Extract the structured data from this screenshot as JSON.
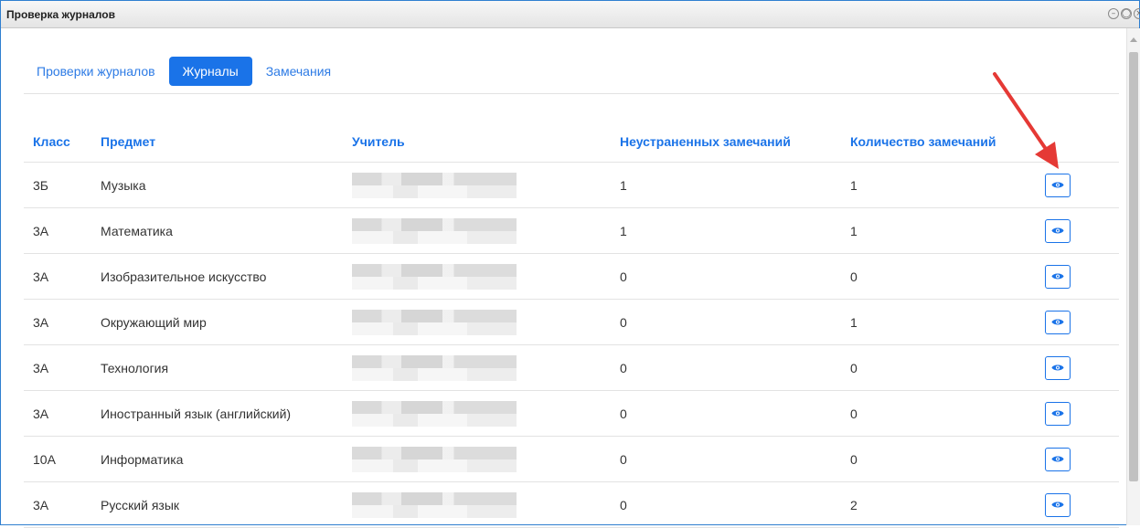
{
  "window": {
    "title": "Проверка журналов",
    "controls": [
      "–",
      "◯",
      "×"
    ]
  },
  "tabs": [
    {
      "label": "Проверки журналов",
      "active": false
    },
    {
      "label": "Журналы",
      "active": true
    },
    {
      "label": "Замечания",
      "active": false
    }
  ],
  "table": {
    "headers": {
      "class": "Класс",
      "subject": "Предмет",
      "teacher": "Учитель",
      "open_remarks": "Неустраненных замечаний",
      "total_remarks": "Количество замечаний"
    },
    "rows": [
      {
        "class": "3Б",
        "subject": "Музыка",
        "open": "1",
        "total": "1"
      },
      {
        "class": "3А",
        "subject": "Математика",
        "open": "1",
        "total": "1"
      },
      {
        "class": "3А",
        "subject": "Изобразительное искусство",
        "open": "0",
        "total": "0"
      },
      {
        "class": "3А",
        "subject": "Окружающий мир",
        "open": "0",
        "total": "1"
      },
      {
        "class": "3А",
        "subject": "Технология",
        "open": "0",
        "total": "0"
      },
      {
        "class": "3А",
        "subject": "Иностранный язык (английский)",
        "open": "0",
        "total": "0"
      },
      {
        "class": "10А",
        "subject": "Информатика",
        "open": "0",
        "total": "0"
      },
      {
        "class": "3А",
        "subject": "Русский язык",
        "open": "0",
        "total": "2"
      }
    ],
    "action_icon": "eye-icon"
  },
  "colors": {
    "accent": "#1a73e8",
    "annotation_arrow": "#e53935"
  }
}
